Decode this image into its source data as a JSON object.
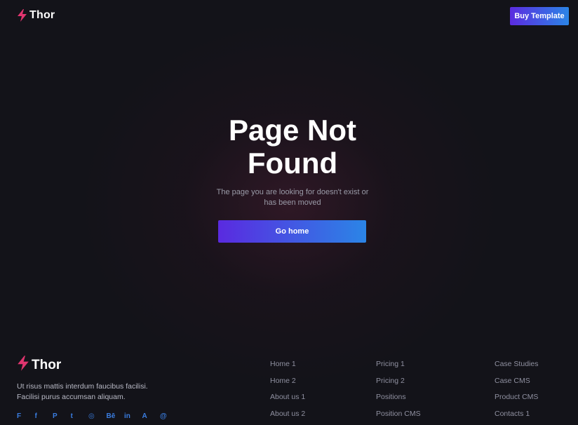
{
  "header": {
    "brand": "Thor",
    "buy_label": "Buy Template"
  },
  "main": {
    "title_line1": "Page Not",
    "title_line2": "Found",
    "subtitle_line1": "The page you are looking for doesn't exist or",
    "subtitle_line2": "has been moved",
    "home_label": "Go home"
  },
  "footer": {
    "brand": "Thor",
    "desc_line1": "Ut risus mattis interdum faucibus facilisi.",
    "desc_line2": "Facilisi purus accumsan aliquam.",
    "social": [
      {
        "icon": "foursquare-icon",
        "glyph": "F"
      },
      {
        "icon": "facebook-icon",
        "glyph": "f"
      },
      {
        "icon": "pinterest-icon",
        "glyph": "P"
      },
      {
        "icon": "twitter-icon",
        "glyph": "t"
      },
      {
        "icon": "instagram-icon",
        "glyph": "◎"
      },
      {
        "icon": "behance-icon",
        "glyph": "Bē"
      },
      {
        "icon": "linkedin-icon",
        "glyph": "in"
      },
      {
        "icon": "airbnb-icon",
        "glyph": "A"
      },
      {
        "icon": "threads-icon",
        "glyph": "@"
      }
    ],
    "col1": [
      "Home 1",
      "Home 2",
      "About us 1",
      "About us 2"
    ],
    "col2": [
      "Pricing 1",
      "Pricing 2",
      "Positions",
      "Position CMS"
    ],
    "col3": [
      "Case Studies",
      "Case CMS",
      "Product CMS",
      "Contacts 1"
    ]
  },
  "colors": {
    "background": "#131319",
    "accent_start": "#5b2be0",
    "accent_end": "#2b85e6",
    "logo_pink": "#e0356f"
  }
}
